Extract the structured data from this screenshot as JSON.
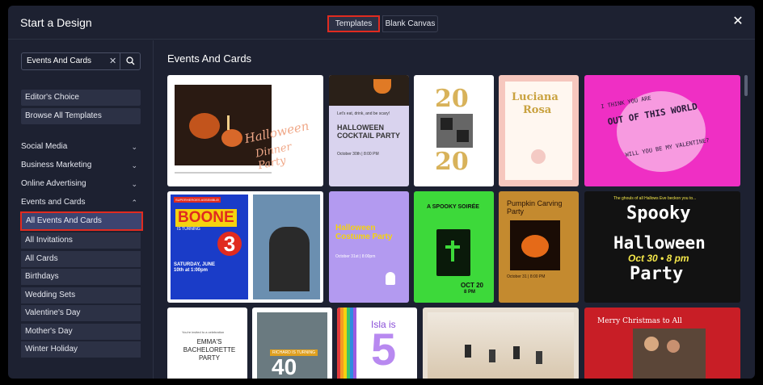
{
  "header": {
    "title": "Start a Design",
    "tab_templates": "Templates",
    "tab_blank": "Blank Canvas",
    "close_glyph": "✕"
  },
  "sidebar": {
    "search_value": "Events And Cards",
    "clear_glyph": "✕",
    "editors_choice": "Editor's Choice",
    "browse_all": "Browse All Templates",
    "categories": [
      {
        "label": "Social Media",
        "chevron": "⌄"
      },
      {
        "label": "Business Marketing",
        "chevron": "⌄"
      },
      {
        "label": "Online Advertising",
        "chevron": "⌄"
      },
      {
        "label": "Events and Cards",
        "chevron": "⌃"
      }
    ],
    "subitems": [
      "All Events And Cards",
      "All Invitations",
      "All Cards",
      "Birthdays",
      "Wedding Sets",
      "Valentine's Day",
      "Mother's Day",
      "Winter Holiday"
    ]
  },
  "main": {
    "title": "Events And Cards"
  },
  "cards": {
    "c1": {
      "main": "Halloween",
      "sub": "Dinner Party"
    },
    "c2": {
      "lead": "Let's eat, drink, and be scary!",
      "main": "HALLOWEEN COCKTAIL PARTY",
      "date": "October 30th | 8:00 PM"
    },
    "c3": {
      "top": "20",
      "bottom": "20"
    },
    "c4": {
      "name1": "Luciana",
      "name2": "Rosa"
    },
    "c5": {
      "line1": "I THINK YOU ARE",
      "line2": "OUT OF THIS WORLD",
      "line3": "WILL YOU BE MY VALENTINE?"
    },
    "c6": {
      "banner": "SUPERHEROES ASSEMBLE!",
      "name": "BOONE",
      "turning": "IS TURNING",
      "age": "3",
      "when": "SATURDAY, JUNE 10th at 1:00pm"
    },
    "c7": {
      "main": "Halloween Costume Party",
      "date": "October 31st | 8:00pm"
    },
    "c8": {
      "main": "A SPOOKY SOIRÉE",
      "date": "OCT 20",
      "time": "8 PM"
    },
    "c9": {
      "main": "Pumpkin Carving Party",
      "time": "October 31 | 8:00 PM"
    },
    "c10": {
      "top": "The ghouls of all Hallows Eve beckon you to...",
      "l1": "Spooky",
      "l2": "Halloween",
      "l3": "Oct 30 • 8 pm",
      "l4": "Party"
    },
    "c11": {
      "lead": "You're invited to a celebration",
      "main": "EMMA'S BACHELORETTE PARTY"
    },
    "c12": {
      "banner": "RICHARD IS TURNING",
      "age": "40"
    },
    "c13": {
      "main": "Isla is",
      "age": "5"
    },
    "c15": {
      "main": "Merry Christmas to All"
    }
  },
  "colors": {
    "modal_bg": "#1d2131",
    "button_bg": "#2c3145",
    "active_bg": "#3c4470",
    "highlight": "#e02b20"
  }
}
